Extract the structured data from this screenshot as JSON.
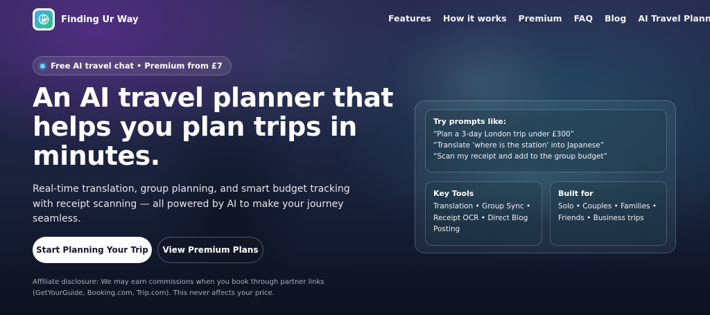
{
  "brand": {
    "name": "Finding Ur Way"
  },
  "nav": {
    "links": [
      "Features",
      "How it works",
      "Premium",
      "FAQ",
      "Blog",
      "AI Travel Planner"
    ]
  },
  "badge": {
    "text": "Free AI travel chat • Premium from £7"
  },
  "hero": {
    "title": "An AI travel planner that helps you plan trips in minutes.",
    "subtitle": "Real-time translation, group planning, and smart budget tracking with receipt scanning — all powered by AI to make your journey seamless.",
    "primary_cta": "Start Planning Your Trip",
    "secondary_cta": "View Premium Plans",
    "disclosure": "Affiliate disclosure: We may earn commissions when you book through partner links (GetYourGuide, Booking.com, Trip.com). This never affects your price."
  },
  "panel": {
    "prompts": {
      "title": "Try prompts like:",
      "items": [
        "“Plan a 3-day London trip under £300”",
        "“Translate 'where is the station' into Japanese”",
        "“Scan my receipt and add to the group budget”"
      ]
    },
    "key_tools": {
      "title": "Key Tools",
      "body": "Translation • Group Sync • Receipt OCR • Direct Blog Posting"
    },
    "built_for": {
      "title": "Built for",
      "body": "Solo • Couples • Families • Friends • Business trips"
    }
  },
  "icons": {
    "logo": "airplane-globe-icon"
  }
}
